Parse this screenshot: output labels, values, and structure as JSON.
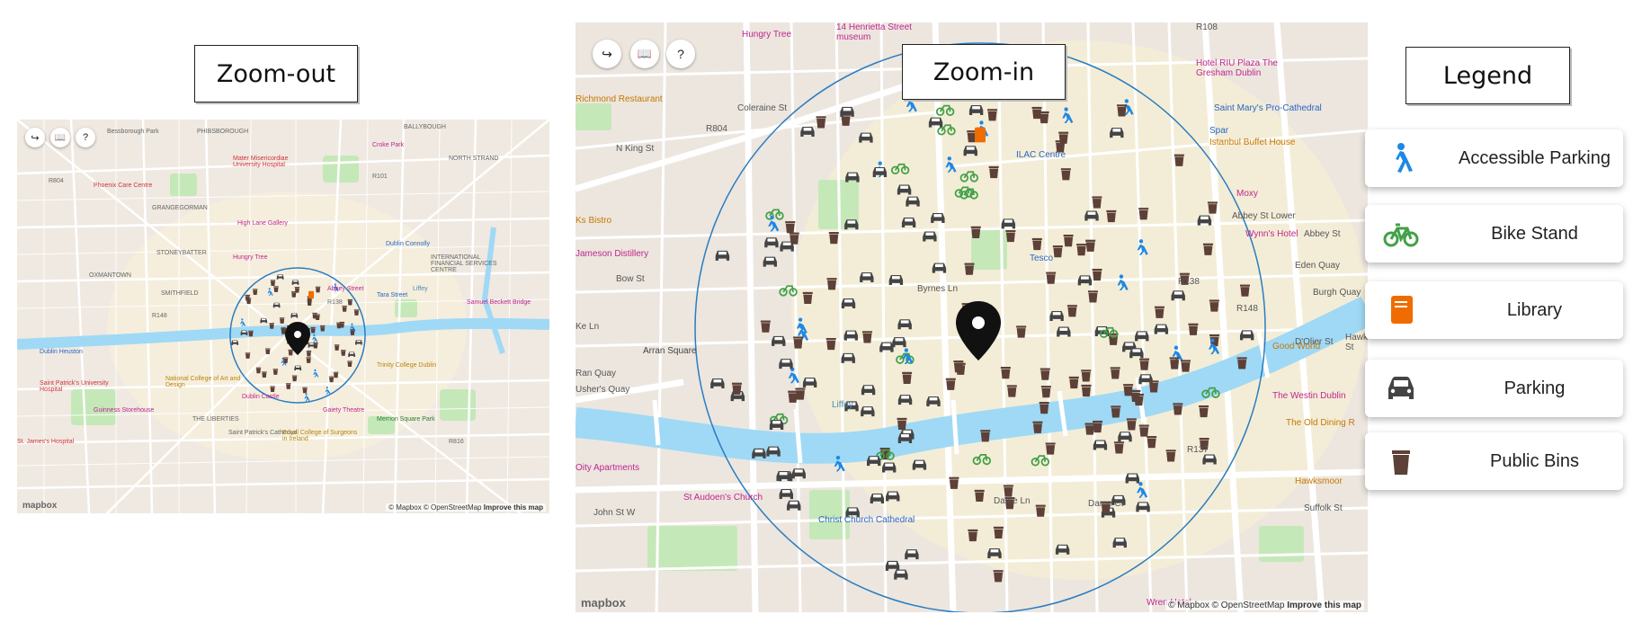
{
  "labels": {
    "zoom_out": "Zoom-out",
    "zoom_in": "Zoom-in",
    "legend": "Legend"
  },
  "controls": [
    {
      "name": "logout-icon",
      "glyph": "↪"
    },
    {
      "name": "book-icon",
      "glyph": "📖"
    },
    {
      "name": "help-icon",
      "glyph": "?"
    }
  ],
  "attribution": {
    "text": "© Mapbox © OpenStreetMap",
    "improve": "Improve this map",
    "logo": "mapbox"
  },
  "colors": {
    "water": "#9fd9f5",
    "park": "#c5e8b8",
    "radius": "#2a7cc0",
    "accessible": "#1e88e5",
    "bike": "#43a047",
    "library": "#ef6c00",
    "parking": "#444444",
    "bins": "#5d4037"
  },
  "legend_items": [
    {
      "name": "Accessible Parking",
      "icon": "accessible-parking-icon"
    },
    {
      "name": "Bike Stand",
      "icon": "bike-stand-icon"
    },
    {
      "name": "Library",
      "icon": "library-icon"
    },
    {
      "name": "Parking",
      "icon": "parking-icon"
    },
    {
      "name": "Public Bins",
      "icon": "public-bins-icon"
    }
  ],
  "zoom_out_labels": [
    "Bessborough Park",
    "PHIBSBOROUGH",
    "BALLYBOUGH",
    "Mater Misericordiae University Hospital",
    "Croke Park",
    "NORTH STRAND",
    "Phoenix Care Centre",
    "R101",
    "GRANGEGORMAN",
    "High Lane Gallery",
    "STONEYBATTER",
    "Dublin Connolly",
    "OXMANTOWN",
    "SMITHFIELD",
    "INTERNATIONAL FINANCIAL SERVICES CENTRE",
    "Dublin Heuston",
    "Abbey Street",
    "Tara Street",
    "Saint Patrick's University Hospital",
    "National College of Art and Design",
    "Trinity College Dublin",
    "Guinness Storehouse",
    "THE LIBERTIES",
    "Dublin Castle",
    "Gaiety Theatre",
    "Merrion Square Park",
    "St. James's Hospital",
    "Saint Patrick's Cathedral",
    "Royal College of Surgeons in Ireland",
    "Samuel Beckett Bridge",
    "Hungry Tree",
    "Liffey",
    "R148",
    "R138",
    "R804",
    "R816"
  ],
  "zoom_in_labels": [
    "14 Henrietta Street museum",
    "Hungry Tree",
    "Hotel RIU Plaza The Gresham Dublin",
    "Richmond Restaurant",
    "Saint Mary's Pro-Cathedral",
    "Spar",
    "Istanbul Buffet House",
    "Coleraine St",
    "N King St",
    "ILAC Centre",
    "Moxy",
    "Abbey St Lower",
    "Wynn's Hotel",
    "Abbey St",
    "Jameson Distillery",
    "Tesco",
    "Eden Quay",
    "Bow St",
    "Byrnes Ln",
    "Burgh Quay",
    "D'Olier St",
    "Hawkins St",
    "Arran Square",
    "Ran Quay",
    "Usher's Quay",
    "Liffey",
    "The Westin Dublin",
    "Good World",
    "The Old Dining R",
    "Hawksmoor",
    "Dame Ln",
    "Dame Ct",
    "Suffolk St",
    "St Audoen's Church",
    "Christ Church Cathedral",
    "Wren Hotel",
    "John St W",
    "Oity Apartments",
    "Ks Bistro",
    "R804",
    "R108",
    "R138",
    "R148",
    "R137",
    "Ke Ln"
  ]
}
